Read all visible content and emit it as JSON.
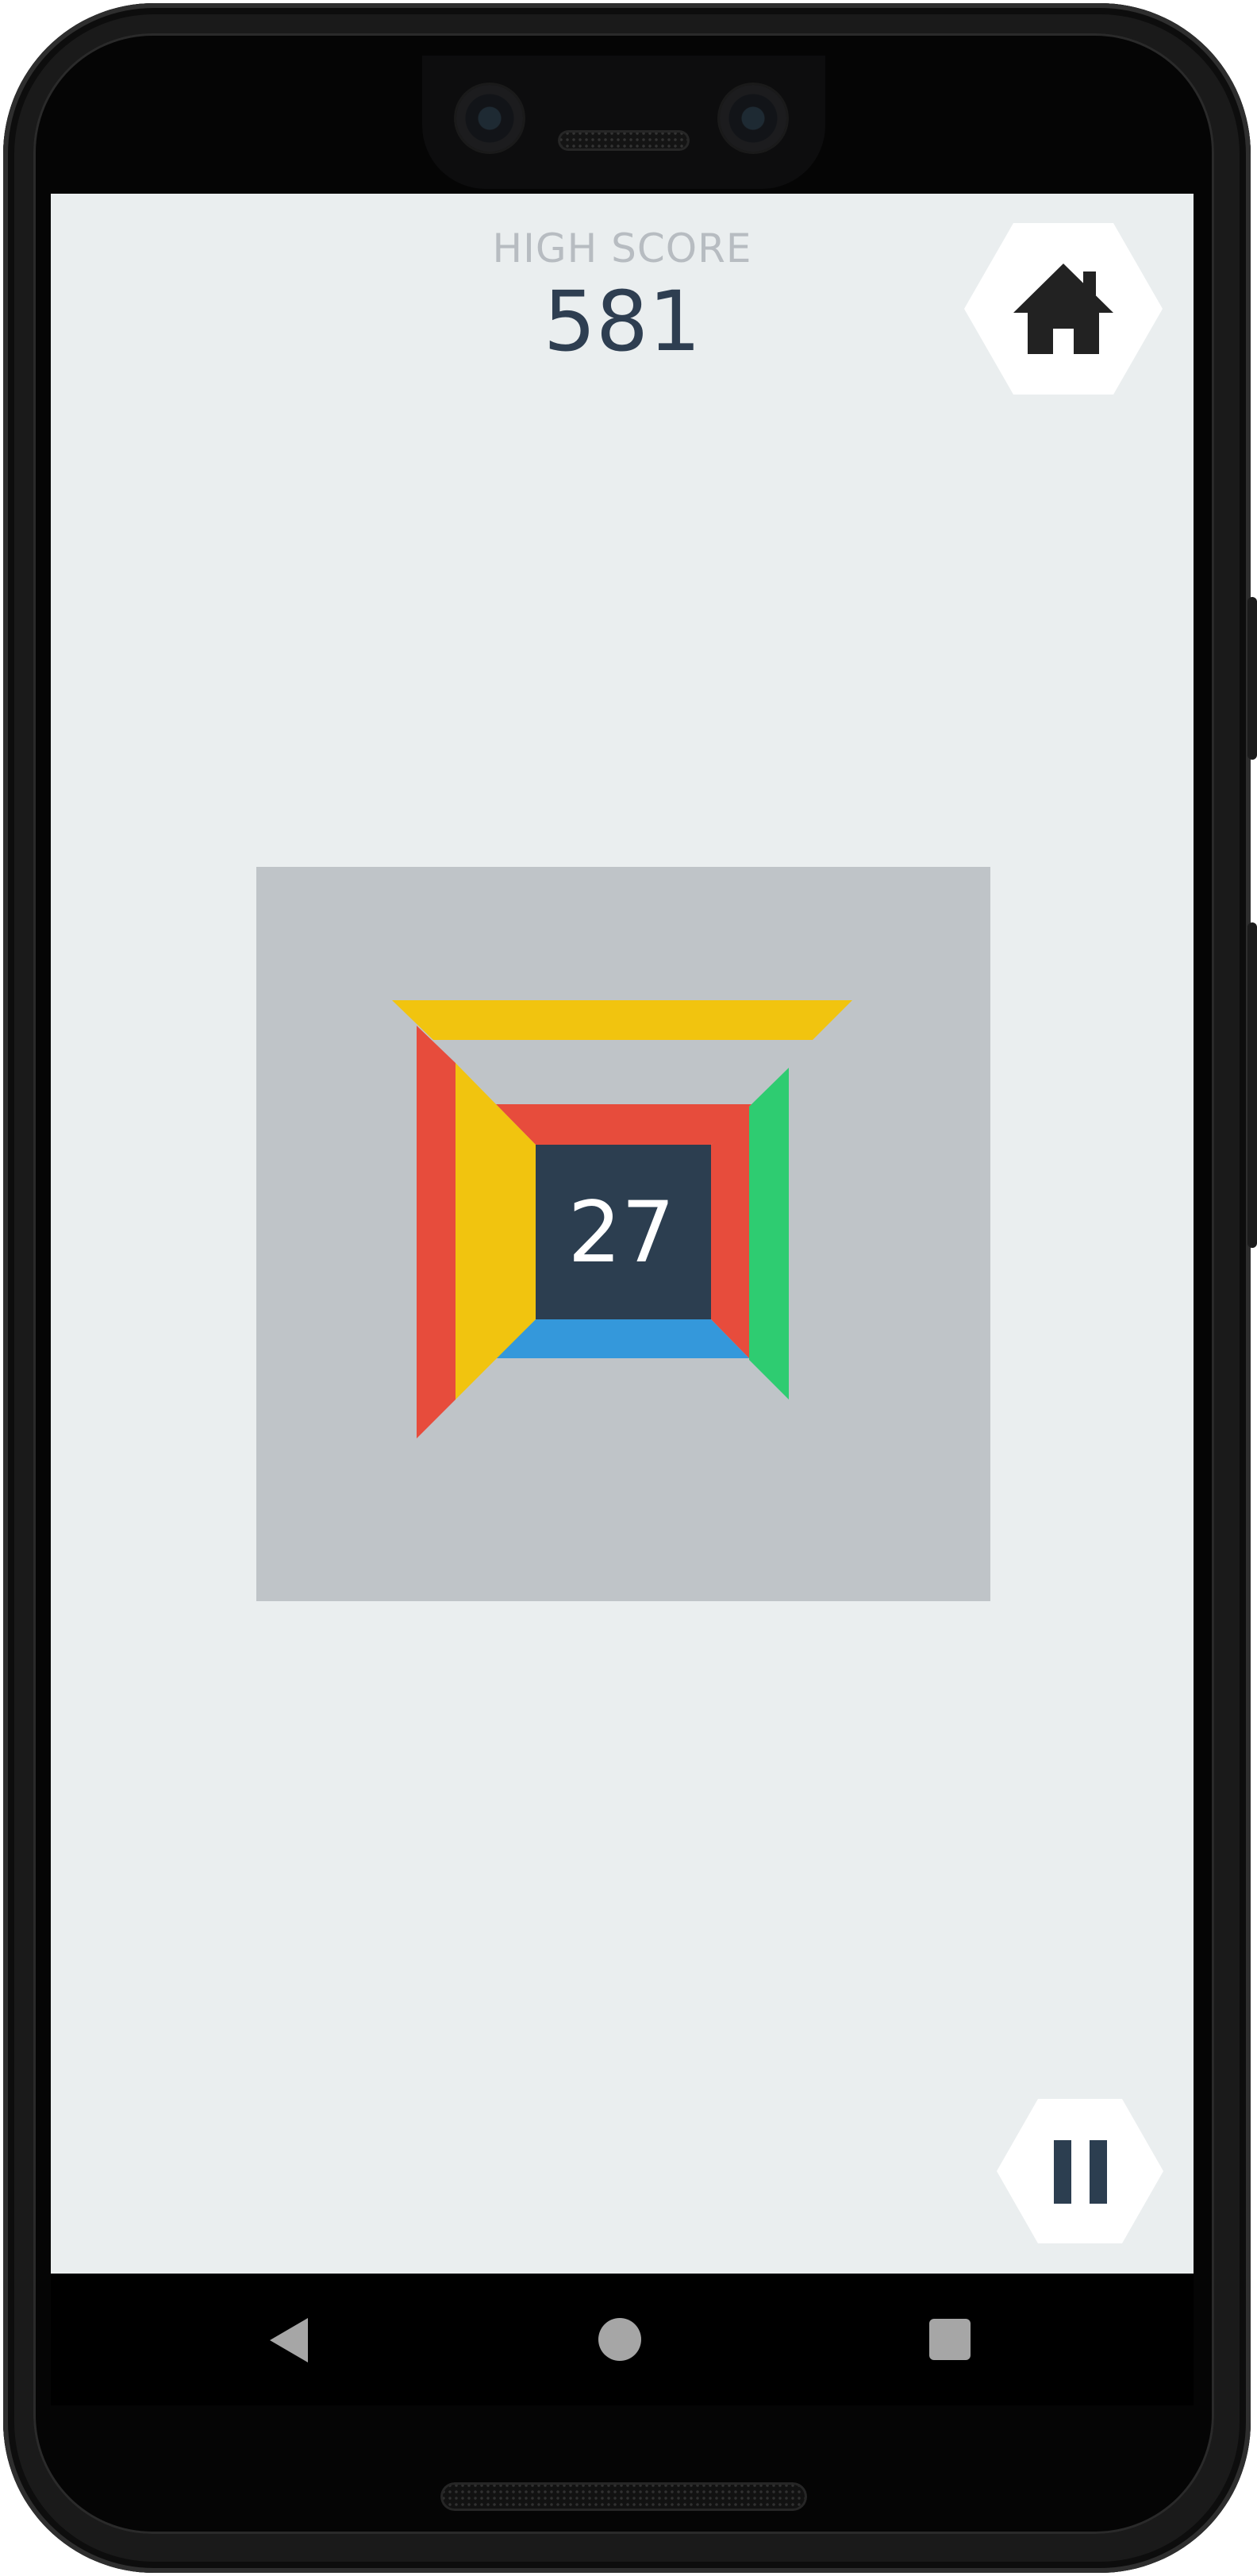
{
  "high_score": {
    "label": "HIGH SCORE",
    "value": "581"
  },
  "game": {
    "current_score": "27",
    "colors": {
      "red": "#e74c3c",
      "yellow": "#f1c40f",
      "green": "#2ecc71",
      "blue": "#3498db",
      "core": "#2c3e50",
      "board": "#bfc4c8",
      "background": "#eaeeef"
    }
  },
  "buttons": {
    "home_icon": "home-icon",
    "pause_icon": "pause-icon"
  },
  "system_nav": {
    "back_icon": "back-triangle-icon",
    "home_icon": "home-circle-icon",
    "recents_icon": "recents-square-icon"
  }
}
